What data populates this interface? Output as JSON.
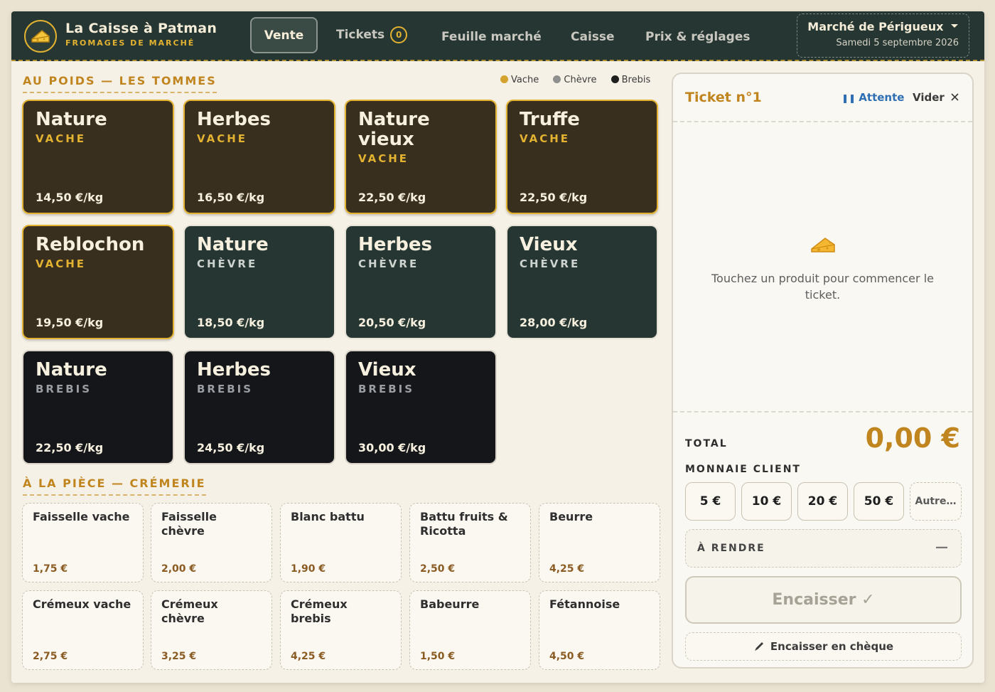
{
  "header": {
    "brand_name": "La Caisse à Patman",
    "brand_sub": "FROMAGES DE MARCHÉ",
    "logo_icon": "cheese-icon",
    "tabs": [
      {
        "label": "Vente",
        "active": true
      },
      {
        "label": "Tickets",
        "count": "0"
      },
      {
        "label": "Feuille marché"
      },
      {
        "label": "Caisse"
      },
      {
        "label": "Prix & réglages"
      }
    ],
    "market": {
      "name": "Marché de Périgueux",
      "date": "Samedi 5 septembre 2026"
    }
  },
  "weight_section": {
    "title": "AU POIDS — LES TOMMES",
    "legend": [
      {
        "label": "Vache",
        "color": "#d4a22e"
      },
      {
        "label": "Chèvre",
        "color": "#8f8f8f"
      },
      {
        "label": "Brebis",
        "color": "#1e1e1e"
      }
    ],
    "products": [
      {
        "name": "Nature",
        "kind": "VACHE",
        "price": "14,50 €/kg"
      },
      {
        "name": "Herbes",
        "kind": "VACHE",
        "price": "16,50 €/kg"
      },
      {
        "name": "Nature vieux",
        "kind": "VACHE",
        "price": "22,50 €/kg"
      },
      {
        "name": "Truffe",
        "kind": "VACHE",
        "price": "22,50 €/kg"
      },
      {
        "name": "Reblochon",
        "kind": "VACHE",
        "price": "19,50 €/kg"
      },
      {
        "name": "Nature",
        "kind": "CHÈVRE",
        "price": "18,50 €/kg"
      },
      {
        "name": "Herbes",
        "kind": "CHÈVRE",
        "price": "20,50 €/kg"
      },
      {
        "name": "Vieux",
        "kind": "CHÈVRE",
        "price": "28,00 €/kg"
      },
      {
        "name": "Nature",
        "kind": "BREBIS",
        "price": "22,50 €/kg"
      },
      {
        "name": "Herbes",
        "kind": "BREBIS",
        "price": "24,50 €/kg"
      },
      {
        "name": "Vieux",
        "kind": "BREBIS",
        "price": "30,00 €/kg"
      }
    ]
  },
  "piece_section": {
    "title": "À LA PIÈCE — CRÉMERIE",
    "products": [
      {
        "name": "Faisselle vache",
        "price": "1,75 €"
      },
      {
        "name": "Faisselle chèvre",
        "price": "2,00 €"
      },
      {
        "name": "Blanc battu",
        "price": "1,90 €"
      },
      {
        "name": "Battu fruits & Ricotta",
        "price": "2,50 €"
      },
      {
        "name": "Beurre",
        "price": "4,25 €"
      },
      {
        "name": "Crémeux vache",
        "price": "2,75 €"
      },
      {
        "name": "Crémeux chèvre",
        "price": "3,25 €"
      },
      {
        "name": "Crémeux brebis",
        "price": "4,25 €"
      },
      {
        "name": "Babeurre",
        "price": "1,50 €"
      },
      {
        "name": "Fétannoise",
        "price": "4,50 €"
      }
    ]
  },
  "ticket": {
    "title": "Ticket n°1",
    "wait_label": "Attente",
    "clear_label": "Vider",
    "empty_icon": "cheese-icon",
    "empty_text": "Touchez un produit pour commencer le ticket.",
    "total_label": "TOTAL",
    "total_value": "0,00 €",
    "change_label": "MONNAIE CLIENT",
    "cash_buttons": [
      "5 €",
      "10 €",
      "20 €",
      "50 €"
    ],
    "other_label": "Autre…",
    "render_label": "À RENDRE",
    "render_value": "—",
    "pay_label": "Encaisser ✓",
    "cheque_label": "Encaisser en chèque"
  }
}
